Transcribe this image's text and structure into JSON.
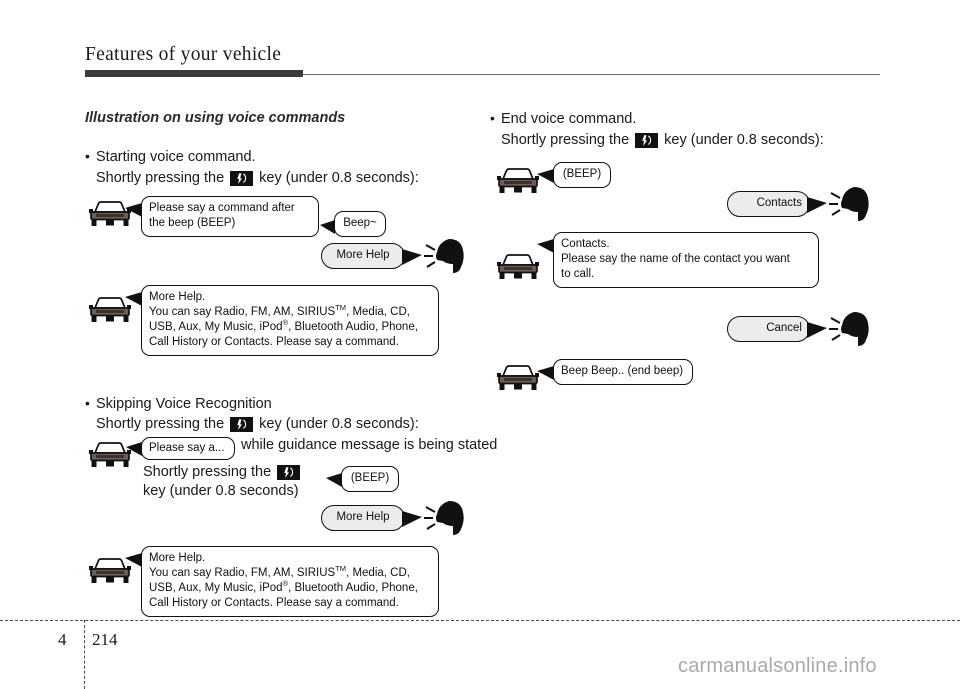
{
  "header": {
    "title": "Features of your vehicle"
  },
  "left": {
    "section_title": "Illustration on using voice commands",
    "start": {
      "bullet": "Starting voice command.",
      "instruction_pre": "Shortly pressing the",
      "instruction_post": "key (under 0.8 seconds):",
      "car_bubble_1_line1": "Please say a command after",
      "car_bubble_1_line2": "the beep (BEEP)",
      "beep_bubble": "Beep~",
      "user_bubble": "More Help",
      "help_title": "More Help.",
      "help_line1_a": "You can say Radio, FM, AM, SIRIUS",
      "help_line1_sup": "TM",
      "help_line1_b": ", Media, CD,",
      "help_line2_a": "USB, Aux, My Music, iPod",
      "help_line2_sup": "®",
      "help_line2_b": ", Bluetooth Audio, Phone,",
      "help_line3": "Call History or Contacts. Please say a command."
    },
    "skip": {
      "bullet": "Skipping Voice Recognition",
      "instruction_pre": "Shortly pressing the",
      "instruction_post": "key (under 0.8 seconds):",
      "car_bubble_short": "Please say a...",
      "while_text": "while guidance message is being stated",
      "press_line1_pre": "Shortly pressing the",
      "press_line2": "key (under 0.8 seconds)",
      "beep_bubble": "(BEEP)",
      "user_bubble": "More Help",
      "help_title": "More Help.",
      "help_line1_a": "You can say Radio, FM, AM, SIRIUS",
      "help_line1_sup": "TM",
      "help_line1_b": ", Media, CD,",
      "help_line2_a": "USB, Aux, My Music, iPod",
      "help_line2_sup": "®",
      "help_line2_b": ", Bluetooth Audio, Phone,",
      "help_line3": "Call History or Contacts. Please say a command."
    }
  },
  "right": {
    "end": {
      "bullet": "End voice command.",
      "instruction_pre": "Shortly pressing the",
      "instruction_post": "key (under 0.8 seconds):",
      "beep_bubble": "(BEEP)",
      "user_bubble_contacts": "Contacts",
      "contacts_line1": "Contacts.",
      "contacts_line2": "Please say the name of the contact you want",
      "contacts_line3": "to call.",
      "user_bubble_cancel": "Cancel",
      "end_beep_bubble": "Beep Beep.. (end beep)"
    }
  },
  "footer": {
    "chapter": "4",
    "page": "214",
    "watermark": "carmanualsonline.info"
  },
  "icons": {
    "voice_key": "voice-command-key-icon",
    "car": "car-icon",
    "head": "speaking-head-icon"
  },
  "colors": {
    "rule": "#3b3b3b",
    "bubble_border": "#111111",
    "bubble_gray": "#ececec",
    "watermark": "#a9a9a9"
  }
}
